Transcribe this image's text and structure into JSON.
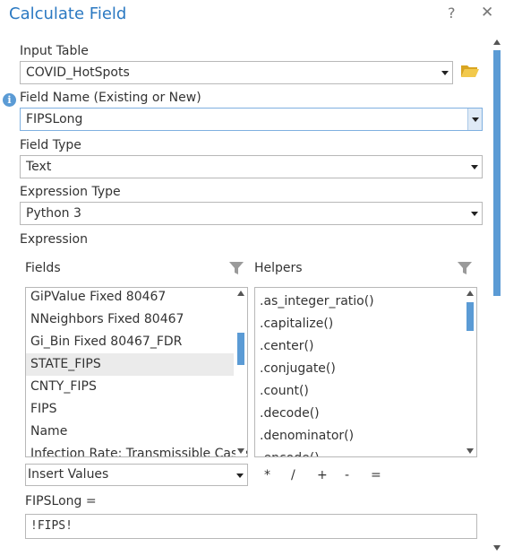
{
  "dialog": {
    "title": "Calculate Field",
    "help_label": "?",
    "close_label": "✕"
  },
  "input_table": {
    "label": "Input Table",
    "value": "COVID_HotSpots",
    "browse_icon": "folder-open-icon"
  },
  "field_name": {
    "label": "Field Name (Existing or New)",
    "value": "FIPSLong",
    "info_icon": "info-icon"
  },
  "field_type": {
    "label": "Field Type",
    "value": "Text"
  },
  "expression_type": {
    "label": "Expression Type",
    "value": "Python 3"
  },
  "expression": {
    "label": "Expression",
    "fields_label": "Fields",
    "helpers_label": "Helpers",
    "fields": [
      "GiPValue Fixed 80467",
      "NNeighbors Fixed 80467",
      "Gi_Bin Fixed 80467_FDR",
      "STATE_FIPS",
      "CNTY_FIPS",
      "FIPS",
      "Name",
      "Infection Rate: Transmissible Cases"
    ],
    "selected_field": "STATE_FIPS",
    "helpers": [
      ".as_integer_ratio()",
      ".capitalize()",
      ".center()",
      ".conjugate()",
      ".count()",
      ".decode()",
      ".denominator()",
      ".encode()"
    ],
    "insert_values_label": "Insert Values",
    "operators": [
      "*",
      "/",
      "+",
      "-",
      "="
    ],
    "code_label": "FIPSLong =",
    "code_value": "!FIPS!"
  },
  "colors": {
    "accent": "#2b79c2",
    "scroll_thumb": "#5b9bd5",
    "folder": "#e8b830"
  }
}
